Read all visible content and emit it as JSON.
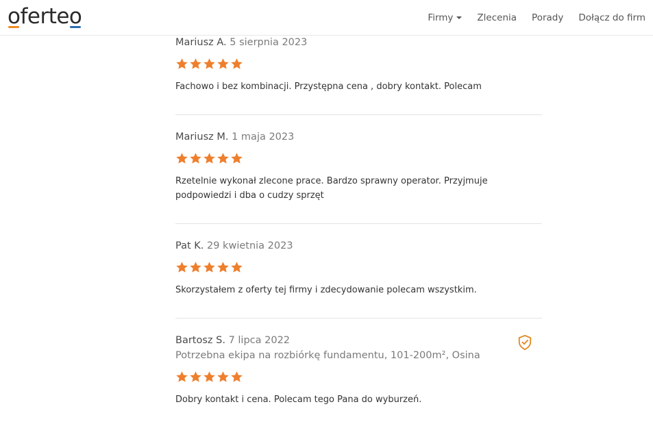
{
  "brand": {
    "logo_text": "oferteo",
    "accent_orange": "#f08a24",
    "accent_blue": "#2b6cb0"
  },
  "nav": {
    "items": [
      {
        "label": "Firmy",
        "has_dropdown": true
      },
      {
        "label": "Zlecenia"
      },
      {
        "label": "Porady"
      },
      {
        "label": "Dołącz do firm"
      }
    ]
  },
  "reviews": [
    {
      "author": "Mariusz A.",
      "date": "5 sierpnia 2023",
      "rating": 5,
      "text": "Fachowo i bez kombinacji. Przystępna cena , dobry kontakt. Polecam"
    },
    {
      "author": "Mariusz M.",
      "date": "1 maja 2023",
      "rating": 5,
      "text": "Rzetelnie wykonał zlecone prace. Bardzo sprawny operator. Przyjmuje podpowiedzi i dba o cudzy sprzęt"
    },
    {
      "author": "Pat K.",
      "date": "29 kwietnia 2023",
      "rating": 5,
      "text": "Skorzystałem z oferty tej firmy i zdecydowanie polecam wszystkim."
    },
    {
      "author": "Bartosz S.",
      "date": "7 lipca 2022",
      "task": "Potrzebna ekipa na rozbiórkę fundamentu, 101-200m², Osina",
      "rating": 5,
      "verified": true,
      "verified_icon": "shield-check-icon",
      "text": "Dobry kontakt i cena. Polecam tego Pana do wyburzeń."
    }
  ],
  "star_color": "#ee7f2d"
}
